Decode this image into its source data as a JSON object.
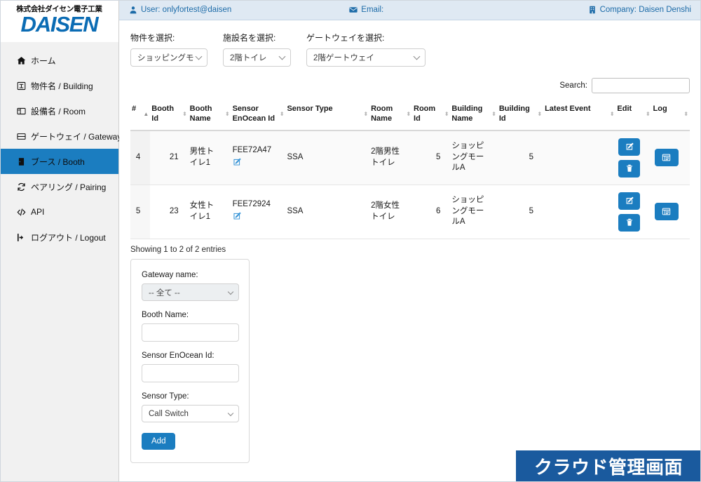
{
  "topbar": {
    "user": "User: onlyfortest@daisen",
    "email": "Email:",
    "company": "Company: Daisen Denshi"
  },
  "sidebar": {
    "logo_jp": "株式会社ダイセン電子工業",
    "logo_main": "DAISEN",
    "items": [
      {
        "label": "ホーム",
        "icon": "home-icon",
        "active": false
      },
      {
        "label": "物件名 / Building",
        "icon": "building-icon",
        "active": false
      },
      {
        "label": "設備名 / Room",
        "icon": "room-icon",
        "active": false
      },
      {
        "label": "ゲートウェイ / Gateway",
        "icon": "gateway-icon",
        "active": false
      },
      {
        "label": "ブース / Booth",
        "icon": "booth-icon",
        "active": true
      },
      {
        "label": "ペアリング / Pairing",
        "icon": "pairing-icon",
        "active": false
      },
      {
        "label": "API",
        "icon": "code-icon",
        "active": false
      },
      {
        "label": "ログアウト / Logout",
        "icon": "logout-icon",
        "active": false
      }
    ]
  },
  "filters": [
    {
      "label": "物件を選択:",
      "value": "ショッピングモ"
    },
    {
      "label": "施設名を選択:",
      "value": "2階トイレ"
    },
    {
      "label": "ゲートウェイを選択:",
      "value": "2階ゲートウェイ"
    }
  ],
  "search": {
    "label": "Search:",
    "value": "",
    "placeholder": ""
  },
  "table": {
    "columns": [
      "#",
      "Booth Id",
      "Booth Name",
      "Sensor EnOcean Id",
      "Sensor Type",
      "Room Name",
      "Room Id",
      "Building Name",
      "Building Id",
      "Latest Event",
      "Edit",
      "Log"
    ],
    "rows": [
      {
        "num": "4",
        "booth_id": "21",
        "booth_name": "男性トイレ1",
        "sensor_enocean_id": "FEE72A47",
        "sensor_type": "SSA",
        "room_name": "2階男性トイレ",
        "room_id": "5",
        "building_name": "ショッピングモールA",
        "building_id": "5",
        "latest_event": ""
      },
      {
        "num": "5",
        "booth_id": "23",
        "booth_name": "女性トイレ1",
        "sensor_enocean_id": "FEE72924",
        "sensor_type": "SSA",
        "room_name": "2階女性トイレ",
        "room_id": "6",
        "building_name": "ショッピングモールA",
        "building_id": "5",
        "latest_event": ""
      }
    ],
    "showing": "Showing 1 to 2 of 2 entries"
  },
  "add_panel": {
    "gateway_label": "Gateway name:",
    "gateway_value": "-- 全て --",
    "booth_label": "Booth Name:",
    "booth_value": "",
    "enocean_label": "Sensor EnOcean Id:",
    "enocean_value": "",
    "sensor_type_label": "Sensor Type:",
    "sensor_type_value": "Call Switch",
    "add_button": "Add"
  },
  "watermark": "クラウド管理画面",
  "colors": {
    "accent": "#1b7dc0",
    "topbar_bg": "#dfe9f3",
    "topbar_text": "#1c6ba8",
    "logo_blue": "#0b6cb4",
    "watermark_bg": "#1a5a9e",
    "sidebar_bg": "#f1f1f1"
  }
}
